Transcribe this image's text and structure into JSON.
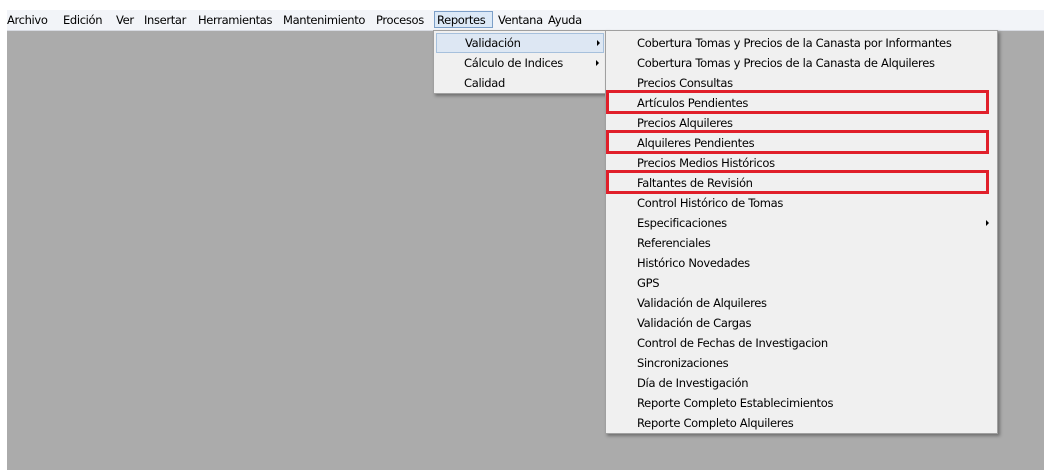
{
  "menubar": {
    "items": [
      "Archivo",
      "Edición",
      "Ver",
      "Insertar",
      "Herramientas",
      "Mantenimiento",
      "Procesos",
      "Reportes",
      "Ventana",
      "Ayuda"
    ],
    "active": "Reportes"
  },
  "reportes_menu": {
    "items": [
      "Validación",
      "Cálculo de Indices",
      "Calidad"
    ],
    "highlighted": "Validación"
  },
  "validacion_menu": {
    "items": [
      "Cobertura Tomas y Precios de la Canasta por Informantes",
      "Cobertura Tomas y Precios de la Canasta de Alquileres",
      "Precios Consultas",
      "Artículos Pendientes",
      "Precios Alquileres",
      "Alquileres Pendientes",
      "Precios Medios Históricos",
      "Faltantes de Revisión",
      "Control Histórico de Tomas",
      "Especificaciones",
      "Referenciales",
      "Histórico Novedades",
      "GPS",
      "Validación de Alquileres",
      "Validación de Cargas",
      "Control de Fechas de Investigacion",
      "Sincronizaciones",
      "Día de Investigación",
      "Reporte Completo Establecimientos",
      "Reporte Completo Alquileres"
    ],
    "submenu_items": [
      "Especificaciones"
    ],
    "annotated_items": [
      "Artículos Pendientes",
      "Alquileres Pendientes",
      "Faltantes de Revisión"
    ]
  },
  "colors": {
    "annotation": "#e01f2a",
    "workspace": "#ababab",
    "menu_background": "#f0f0f0",
    "highlight": "#dde7f3"
  },
  "icons": {
    "submenu_arrow": "chevron-right-icon"
  }
}
